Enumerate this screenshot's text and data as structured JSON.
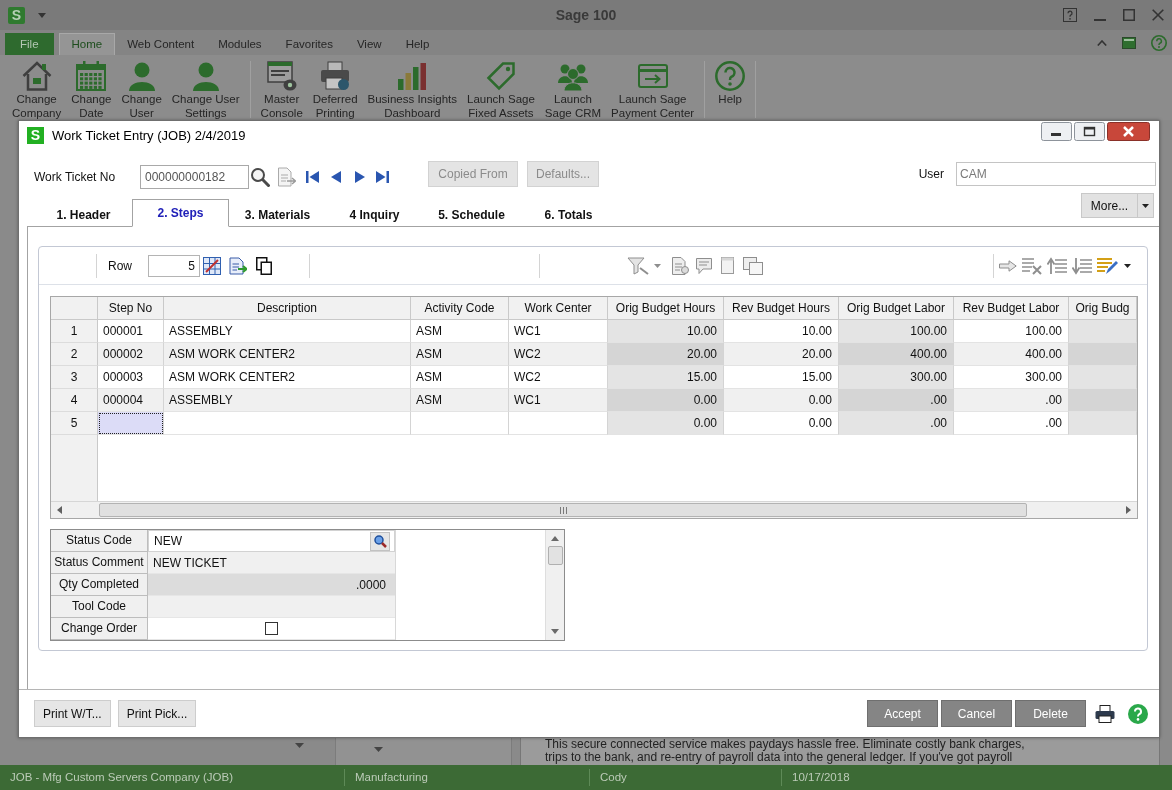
{
  "app": {
    "logo": "S",
    "title": "Sage 100",
    "menu_tabs": [
      {
        "label": "File",
        "kind": "file",
        "selected": false
      },
      {
        "label": "Home",
        "kind": "tab",
        "selected": true
      },
      {
        "label": "Web Content",
        "kind": "tab",
        "selected": false
      },
      {
        "label": "Modules",
        "kind": "tab",
        "selected": false
      },
      {
        "label": "Favorites",
        "kind": "tab",
        "selected": false
      },
      {
        "label": "View",
        "kind": "tab",
        "selected": false
      },
      {
        "label": "Help",
        "kind": "tab",
        "selected": false
      }
    ],
    "ribbon_groups": [
      {
        "buttons": [
          {
            "lines": [
              "Change",
              "Company"
            ]
          },
          {
            "lines": [
              "Change",
              "Date"
            ]
          },
          {
            "lines": [
              "Change",
              "User"
            ]
          },
          {
            "lines": [
              "Change User",
              "Settings"
            ]
          }
        ]
      },
      {
        "buttons": [
          {
            "lines": [
              "Master",
              "Console"
            ]
          },
          {
            "lines": [
              "Deferred",
              "Printing"
            ]
          },
          {
            "lines": [
              "Business Insights",
              "Dashboard"
            ]
          },
          {
            "lines": [
              "Launch Sage",
              "Fixed Assets"
            ]
          },
          {
            "lines": [
              "Launch",
              "Sage CRM"
            ]
          },
          {
            "lines": [
              "Launch Sage",
              "Payment Center"
            ]
          }
        ]
      },
      {
        "buttons": [
          {
            "lines": [
              "Help"
            ]
          }
        ]
      }
    ],
    "notice_lines": [
      "This secure connected service makes paydays hassle free. Eliminate costly bank charges,",
      "trips to the bank, and re-entry of payroll data into the general ledger. If you've got payroll"
    ],
    "status_bar": [
      "JOB - Mfg Custom Servers Company (JOB)",
      "Manufacturing",
      "Cody",
      "10/17/2018"
    ]
  },
  "dialog": {
    "logo": "S",
    "title": "Work Ticket Entry (JOB) 2/4/2019",
    "work_ticket_no": {
      "label": "Work Ticket No",
      "value": "000000000182"
    },
    "header_buttons": [
      {
        "label": "Copied From",
        "disabled": true
      },
      {
        "label": "Defaults...",
        "disabled": true
      }
    ],
    "user": {
      "label": "User",
      "value": "CAM",
      "disabled": true
    },
    "tabs": [
      {
        "label": "1. Header",
        "selected": false
      },
      {
        "label": "2. Steps",
        "selected": true
      },
      {
        "label": "3. Materials",
        "selected": false
      },
      {
        "label": "4 Inquiry",
        "selected": false
      },
      {
        "label": "5. Schedule",
        "selected": false
      },
      {
        "label": "6. Totals",
        "selected": false
      }
    ],
    "more_button": "More...",
    "row_field": {
      "label": "Row",
      "value": "5"
    },
    "grid": {
      "columns": [
        {
          "label": "Step No",
          "kind": "text",
          "read_only": false
        },
        {
          "label": "Description",
          "kind": "text",
          "read_only": false
        },
        {
          "label": "Activity Code",
          "kind": "text",
          "read_only": false
        },
        {
          "label": "Work Center",
          "kind": "text",
          "read_only": false
        },
        {
          "label": "Orig Budget Hours",
          "kind": "number",
          "read_only": true
        },
        {
          "label": "Rev Budget Hours",
          "kind": "number",
          "read_only": false
        },
        {
          "label": "Orig Budget Labor",
          "kind": "number",
          "read_only": true
        },
        {
          "label": "Rev Budget Labor",
          "kind": "number",
          "read_only": false
        },
        {
          "label": "Orig Budg",
          "kind": "number",
          "read_only": true
        }
      ],
      "rows": [
        {
          "number": "1",
          "selected": false,
          "cells": [
            "000001",
            "ASSEMBLY",
            "ASM",
            "WC1",
            "10.00",
            "10.00",
            "100.00",
            "100.00"
          ]
        },
        {
          "number": "2",
          "selected": false,
          "cells": [
            "000002",
            "ASM WORK CENTER2",
            "ASM",
            "WC2",
            "20.00",
            "20.00",
            "400.00",
            "400.00"
          ]
        },
        {
          "number": "3",
          "selected": false,
          "cells": [
            "000003",
            "ASM WORK CENTER2",
            "ASM",
            "WC2",
            "15.00",
            "15.00",
            "300.00",
            "300.00"
          ]
        },
        {
          "number": "4",
          "selected": false,
          "cells": [
            "000004",
            "ASSEMBLY",
            "ASM",
            "WC1",
            "0.00",
            "0.00",
            ".00",
            ".00"
          ]
        },
        {
          "number": "5",
          "selected": true,
          "cells": [
            null,
            null,
            null,
            null,
            "0.00",
            "0.00",
            ".00",
            ".00"
          ]
        }
      ]
    },
    "status_fields": [
      {
        "label": "Status Code",
        "kind": "lookup",
        "value": "NEW",
        "read_only": false
      },
      {
        "label": "Status Comment",
        "kind": "text",
        "value": "NEW TICKET",
        "read_only": false
      },
      {
        "label": "Qty Completed",
        "kind": "number",
        "value": ".0000",
        "read_only": true
      },
      {
        "label": "Tool Code",
        "kind": "text",
        "read_only": false
      },
      {
        "label": "Change Order",
        "kind": "checkbox",
        "checked": false,
        "read_only": false
      }
    ],
    "left_buttons": [
      "Print W/T...",
      "Print Pick..."
    ],
    "right_buttons": [
      "Accept",
      "Cancel",
      "Delete"
    ]
  }
}
